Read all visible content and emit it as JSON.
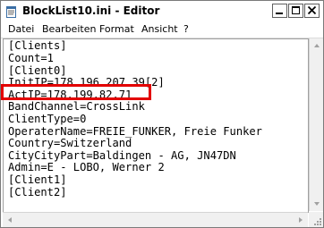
{
  "window": {
    "title": "BlockList10.ini - Editor"
  },
  "menu": {
    "items": [
      "Datei",
      "Bearbeiten",
      "Format",
      "Ansicht",
      "?"
    ]
  },
  "editor": {
    "lines": [
      "[Clients]",
      "Count=1",
      "[Client0]",
      "InitIP=178.196.207.39[2]",
      "ActIP=178.199.82.71",
      "BandChannel=CrossLink",
      "ClientType=0",
      "OperaterName=FREIE_FUNKER, Freie Funker",
      "Country=Switzerland",
      "CityCityPart=Baldingen - AG, JN47DN",
      "Admin=E - LOBO, Werner 2",
      "[Client1]",
      "[Client2]"
    ],
    "highlighted_line": 4,
    "highlight_color": "#e30000"
  },
  "icons": {
    "app": "notepad-icon",
    "minimize": "minimize-icon",
    "maximize": "maximize-icon",
    "close": "close-icon"
  }
}
